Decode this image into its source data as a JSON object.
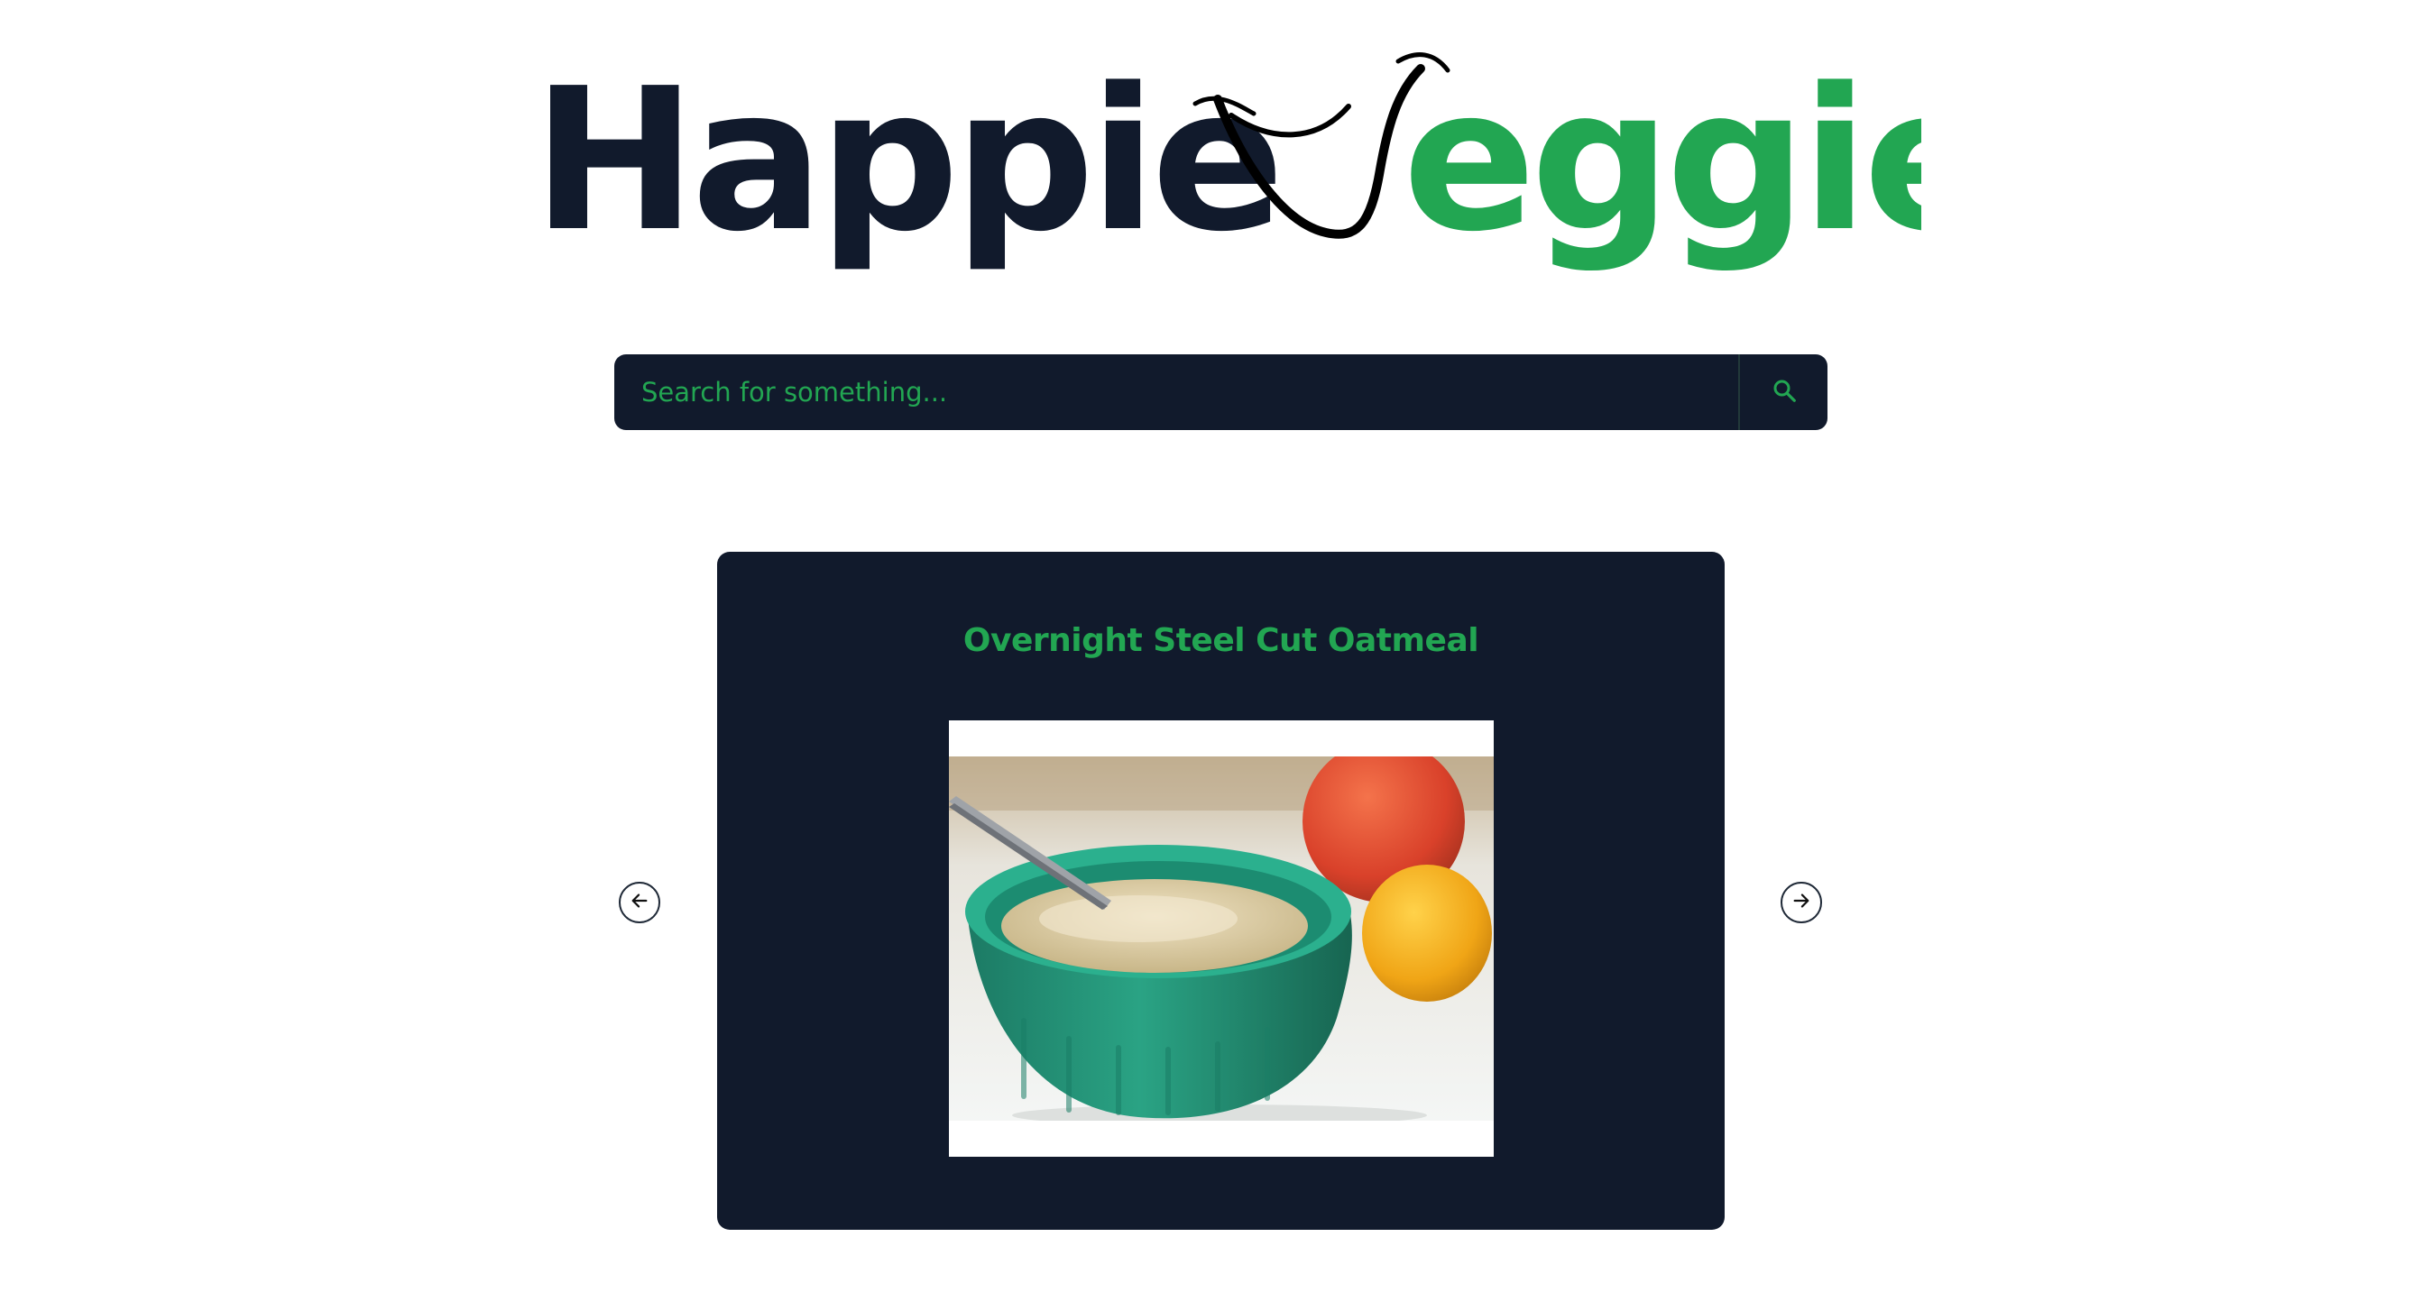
{
  "logo": {
    "part1": "Happie",
    "part2": "eggie",
    "mark": "smiling-v-mark"
  },
  "search": {
    "placeholder": "Search for something...",
    "icon": "search-icon"
  },
  "carousel": {
    "prev_icon": "arrow-left-icon",
    "next_icon": "arrow-right-icon",
    "current": {
      "title": "Overnight Steel Cut Oatmeal",
      "image_alt": "Bowl of oatmeal with orange and lemon"
    }
  },
  "colors": {
    "navy": "#111a2c",
    "green": "#22a652",
    "background": "#ffffff"
  }
}
